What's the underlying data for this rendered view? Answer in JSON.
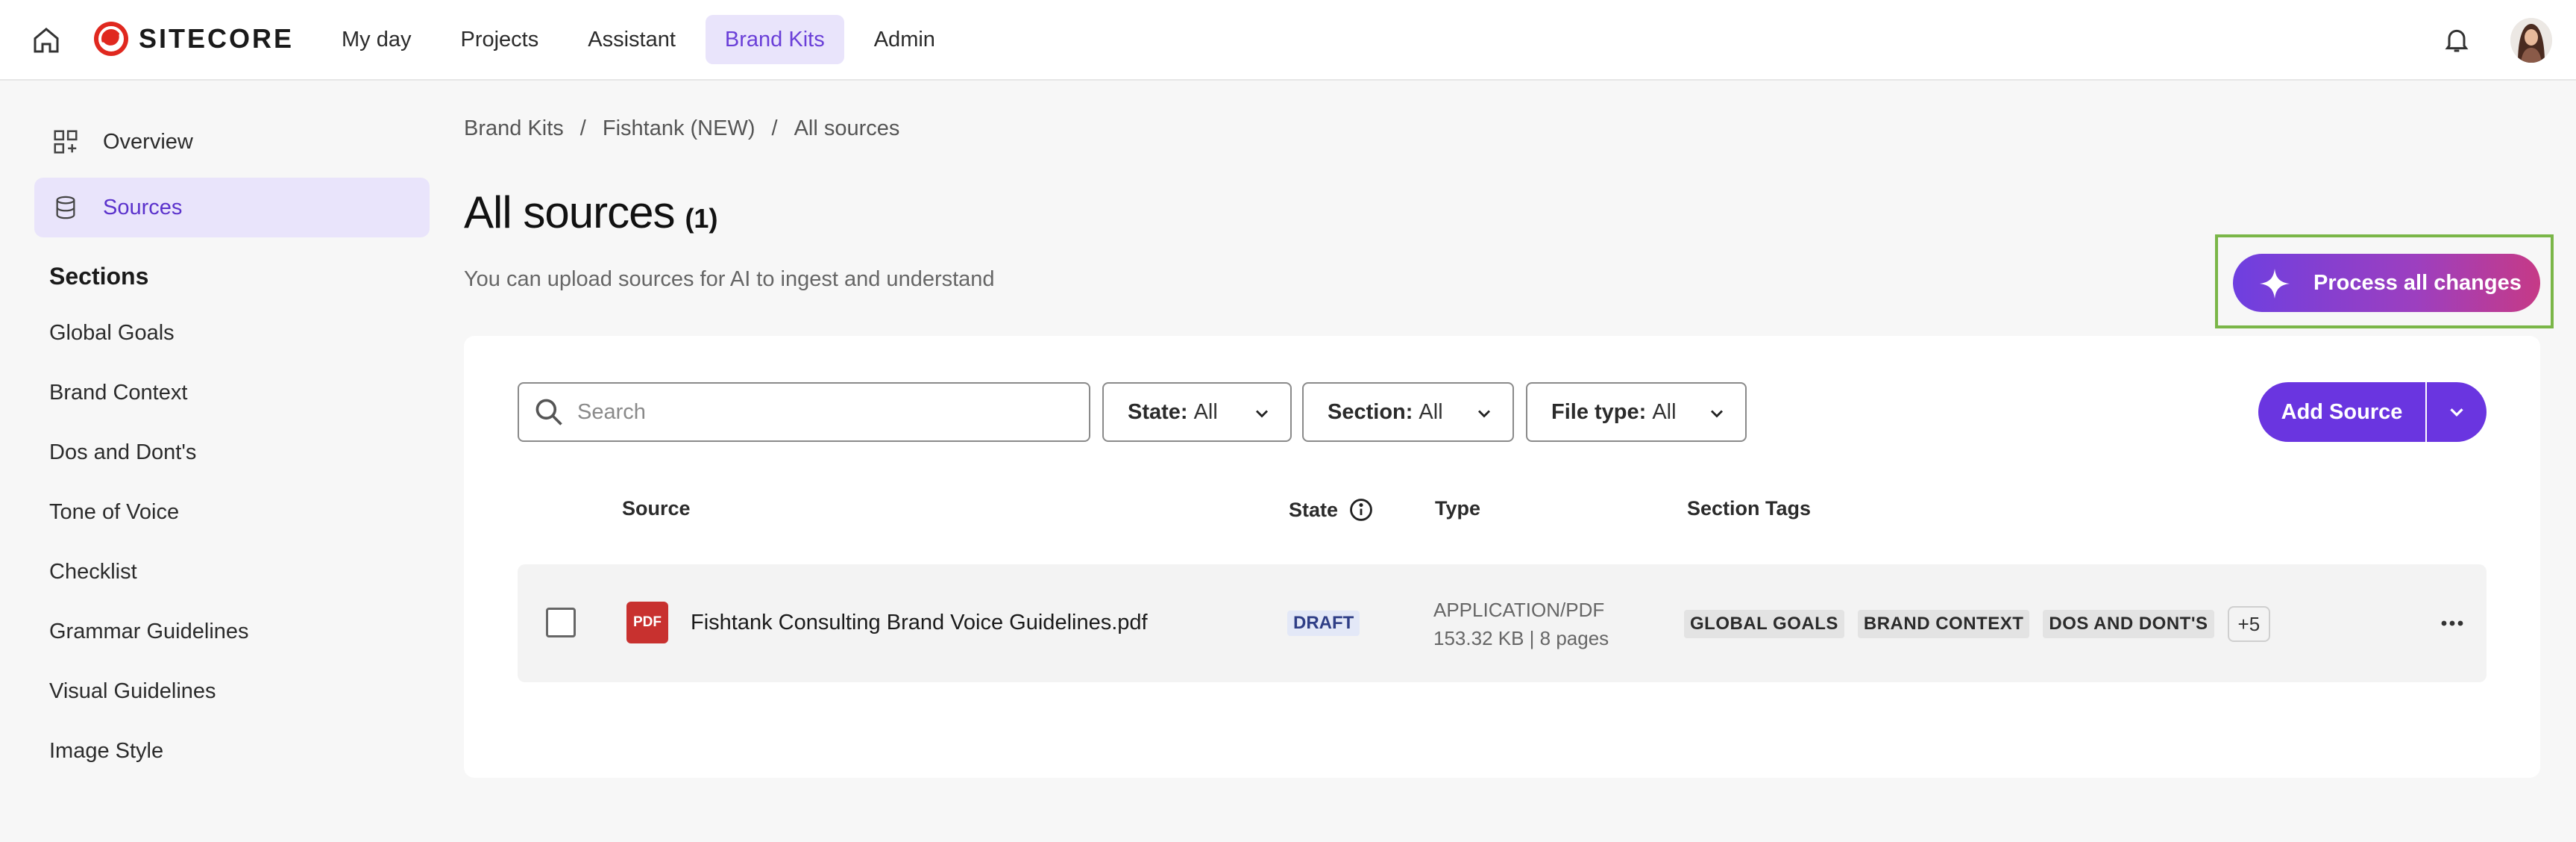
{
  "topbar": {
    "logo_text": "SITECORE",
    "nav": [
      {
        "label": "My day",
        "active": false
      },
      {
        "label": "Projects",
        "active": false
      },
      {
        "label": "Assistant",
        "active": false
      },
      {
        "label": "Brand Kits",
        "active": true
      },
      {
        "label": "Admin",
        "active": false
      }
    ],
    "icons": {
      "home": "home-icon",
      "bell": "bell-icon",
      "avatar": "user-avatar"
    }
  },
  "sidebar": {
    "top_items": [
      {
        "label": "Overview",
        "icon": "grid-plus-icon",
        "active": false
      },
      {
        "label": "Sources",
        "icon": "database-icon",
        "active": true
      }
    ],
    "sections_heading": "Sections",
    "sections": [
      "Global Goals",
      "Brand Context",
      "Dos and Dont's",
      "Tone of Voice",
      "Checklist",
      "Grammar Guidelines",
      "Visual Guidelines",
      "Image Style"
    ]
  },
  "breadcrumb": [
    "Brand Kits",
    "Fishtank (NEW)",
    "All sources"
  ],
  "breadcrumb_separator": "/",
  "page": {
    "title": "All sources",
    "count": "(1)",
    "subtitle": "You can upload sources for AI to ingest and understand",
    "process_button": "Process all changes"
  },
  "toolbar": {
    "search_placeholder": "Search",
    "filters": [
      {
        "label": "State:",
        "value": "All"
      },
      {
        "label": "Section:",
        "value": "All"
      },
      {
        "label": "File type:",
        "value": "All"
      }
    ],
    "add_source": "Add Source"
  },
  "table": {
    "headers": {
      "source": "Source",
      "state": "State",
      "type": "Type",
      "section_tags": "Section Tags"
    },
    "rows": [
      {
        "file_icon_text": "PDF",
        "name": "Fishtank Consulting Brand Voice Guidelines.pdf",
        "state": "DRAFT",
        "type": "APPLICATION/PDF",
        "meta": "153.32 KB | 8 pages",
        "tags": [
          "GLOBAL GOALS",
          "BRAND CONTEXT",
          "DOS AND DONT'S"
        ],
        "more_tags": "+5"
      }
    ]
  },
  "colors": {
    "accent": "#6a35e0",
    "active_bg": "#e9e4fb",
    "highlight_border": "#7ab648",
    "pdf_red": "#c8312f"
  }
}
